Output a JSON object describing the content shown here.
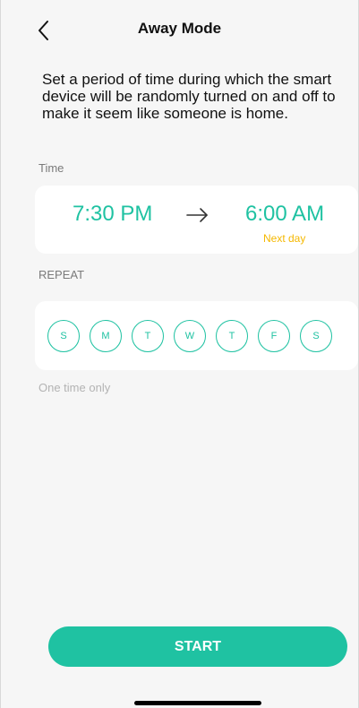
{
  "header": {
    "title": "Away Mode",
    "back_icon": "chevron-left-icon"
  },
  "description": "Set a period of time during which the smart device will be randomly turned on and off to make it seem like someone is home.",
  "time": {
    "label": "Time",
    "start": "7:30 PM",
    "end": "6:00 AM",
    "end_note": "Next day",
    "arrow_icon": "arrow-right-icon"
  },
  "repeat": {
    "label": "REPEAT",
    "days": [
      "S",
      "M",
      "T",
      "W",
      "T",
      "F",
      "S"
    ],
    "hint": "One time only"
  },
  "start_button": {
    "label": "START"
  },
  "colors": {
    "accent": "#1fc2a2",
    "note": "#f5b800",
    "background": "#f6f6f6"
  }
}
